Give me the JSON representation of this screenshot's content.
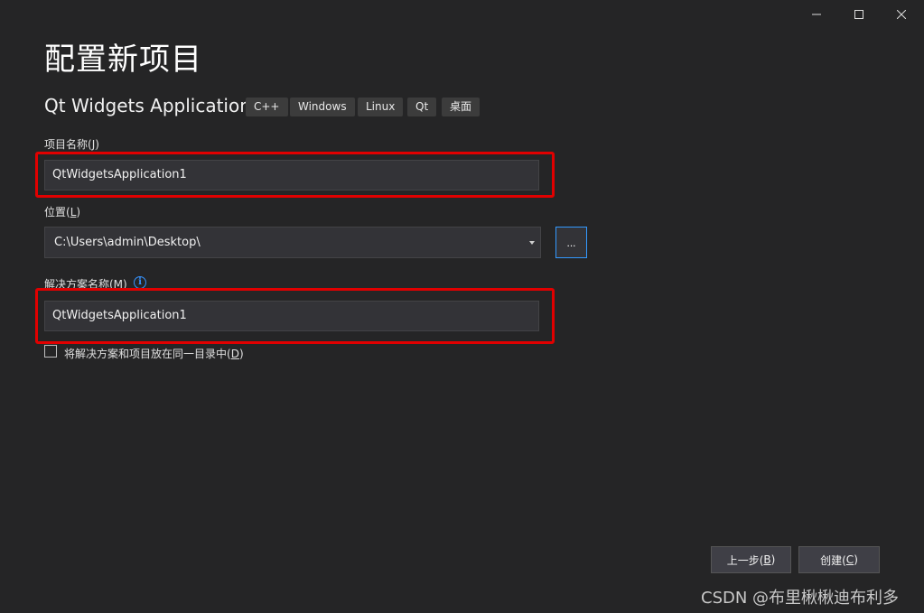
{
  "window_controls": {
    "minimize": "minimize",
    "maximize": "maximize",
    "close": "close"
  },
  "page": {
    "title": "配置新项目"
  },
  "template": {
    "name": "Qt Widgets Application",
    "tags": [
      "C++",
      "Windows",
      "Linux",
      "Qt",
      "桌面"
    ]
  },
  "project_name": {
    "label": "项目名称(",
    "accel": "J",
    "label_end": ")",
    "value": "QtWidgetsApplication1"
  },
  "location": {
    "label": "位置(",
    "accel": "L",
    "label_end": ")",
    "value": "C:\\Users\\admin\\Desktop\\",
    "browse_label": "..."
  },
  "solution_name": {
    "label": "解决方案名称(M)",
    "info": "i",
    "value": "QtWidgetsApplication1"
  },
  "same_dir": {
    "label": "将解决方案和项目放在同一目录中(",
    "accel": "D",
    "label_end": ")",
    "checked": false
  },
  "buttons": {
    "back": {
      "label": "上一步(",
      "accel": "B",
      "label_end": ")"
    },
    "create": {
      "label": "创建(",
      "accel": "C",
      "label_end": ")"
    }
  },
  "watermark": "CSDN @布里楸楸迪布利多",
  "colors": {
    "background": "#252526",
    "highlight": "#e10000",
    "accent": "#3399ff"
  }
}
